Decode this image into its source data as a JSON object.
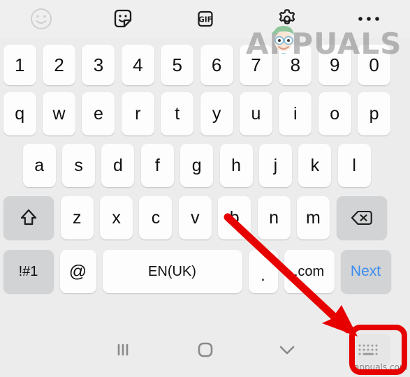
{
  "toolbar": {
    "items": [
      {
        "name": "emoji-icon",
        "label": "Emoji"
      },
      {
        "name": "sticker-icon",
        "label": "Sticker"
      },
      {
        "name": "gif-icon",
        "label": "GIF"
      },
      {
        "name": "settings-gear-icon",
        "label": "Settings"
      },
      {
        "name": "more-options-icon",
        "label": "More options"
      }
    ],
    "gif_label": "GIF"
  },
  "keyboard": {
    "language": "EN(UK)",
    "rows": {
      "numbers": [
        "1",
        "2",
        "3",
        "4",
        "5",
        "6",
        "7",
        "8",
        "9",
        "0"
      ],
      "top": [
        "q",
        "w",
        "e",
        "r",
        "t",
        "y",
        "u",
        "i",
        "o",
        "p"
      ],
      "home": [
        "a",
        "s",
        "d",
        "f",
        "g",
        "h",
        "j",
        "k",
        "l"
      ],
      "bottom": [
        "z",
        "x",
        "c",
        "v",
        "b",
        "n",
        "m"
      ]
    },
    "shift_label": "shift-key",
    "backspace_label": "backspace-key",
    "function_row": {
      "symbols": "!#1",
      "at": "@",
      "space": "EN(UK)",
      "period": ".",
      "dotcom": ".com",
      "next": "Next"
    }
  },
  "navbar": {
    "recents_label": "Recent apps",
    "home_label": "Home",
    "hide_keyboard_label": "Hide keyboard",
    "keyboard_switch_label": "Keyboard layout switch"
  },
  "annotation": {
    "arrow_target": "keyboard-switch-button",
    "highlight_color": "#e60000"
  },
  "watermark": {
    "text": "APPUALS",
    "footer": "appuals.com"
  }
}
